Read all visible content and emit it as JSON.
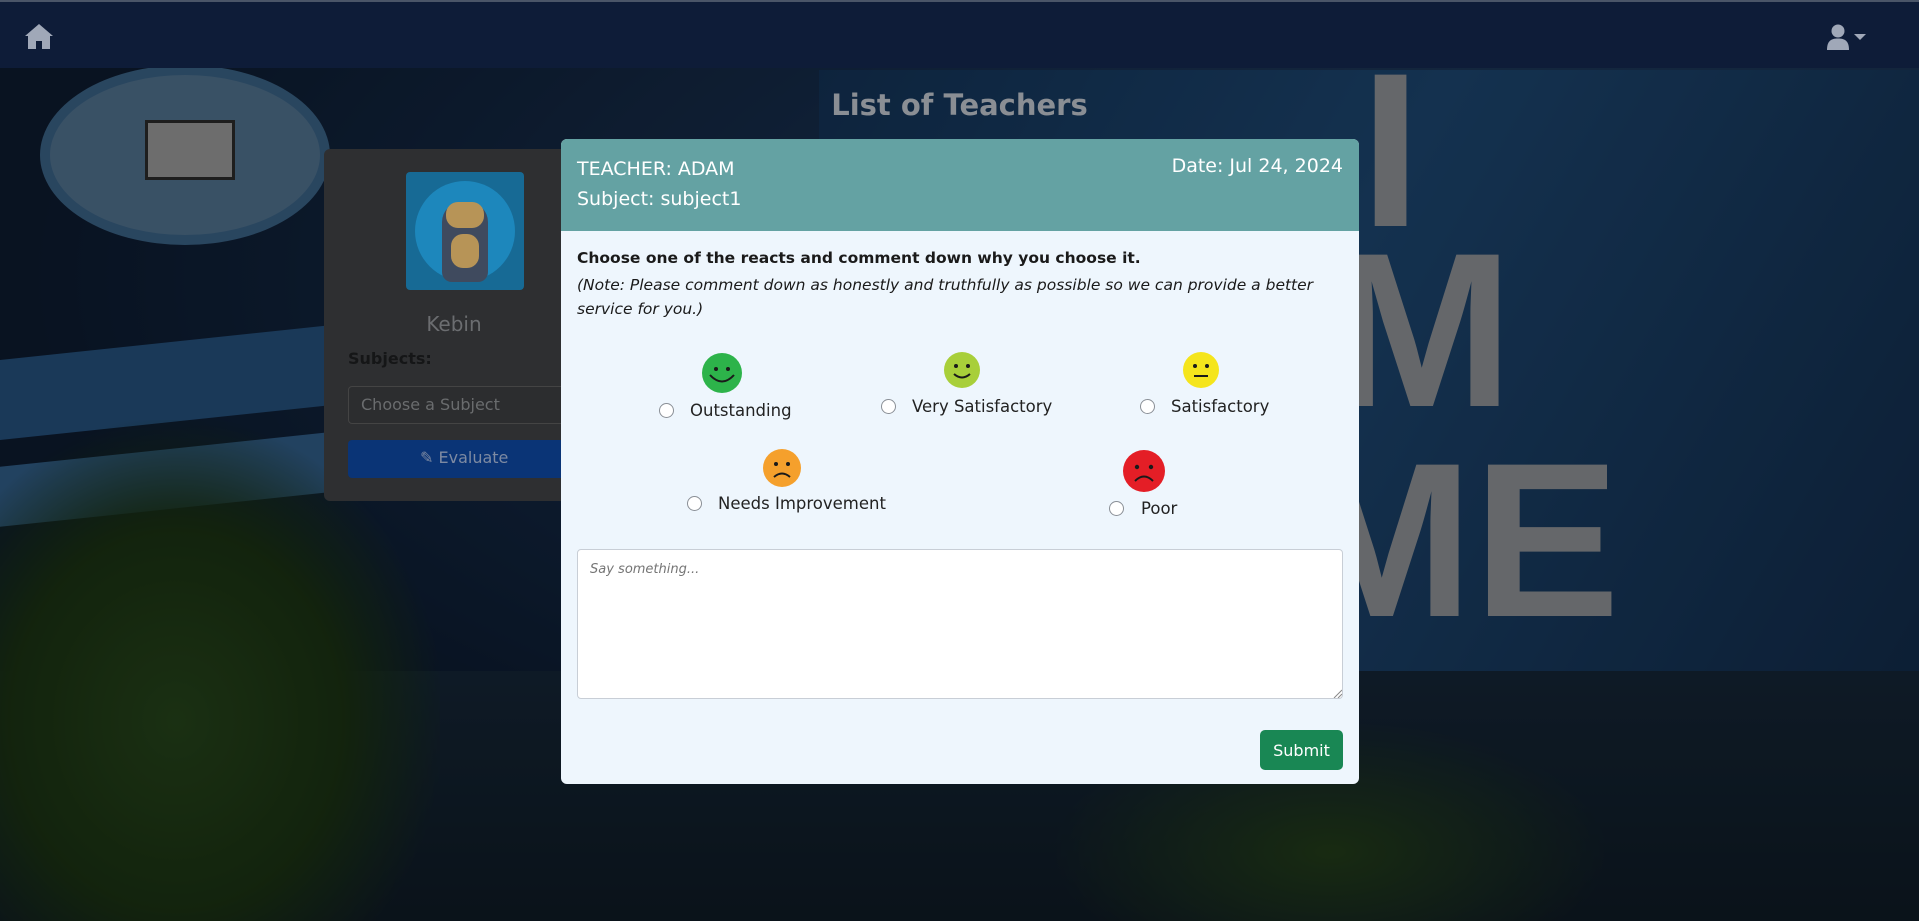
{
  "page": {
    "title": "List of Teachers"
  },
  "navbar": {
    "home_icon": "home-icon",
    "user_icon": "user-icon"
  },
  "teacher_card": {
    "name": "Kebin",
    "subjects_label": "Subjects:",
    "select_placeholder": "Choose a Subject",
    "evaluate_label": "Evaluate",
    "evaluate_icon": "pencil-icon"
  },
  "modal": {
    "teacher": "TEACHER: ADAM",
    "subject": "Subject: subject1",
    "date": "Date: Jul 24, 2024",
    "instruction": "Choose one of the reacts and comment down why you choose it.",
    "note": "(Note: Please comment down as honestly and truthfully as possible so we can provide a better service for you.)",
    "reacts": [
      {
        "label": "Outstanding",
        "color": "#2db34a",
        "icon": "big-smile-icon"
      },
      {
        "label": "Very Satisfactory",
        "color": "#a8cf3a",
        "icon": "smile-icon"
      },
      {
        "label": "Satisfactory",
        "color": "#f5e51c",
        "icon": "neutral-face-icon"
      },
      {
        "label": "Needs Improvement",
        "color": "#f5a02c",
        "icon": "frown-icon"
      },
      {
        "label": "Poor",
        "color": "#e41e26",
        "icon": "sad-face-icon"
      }
    ],
    "comment_placeholder": "Say something...",
    "submit_label": "Submit",
    "submit_color": "#198754",
    "header_color": "#64a2a3"
  }
}
